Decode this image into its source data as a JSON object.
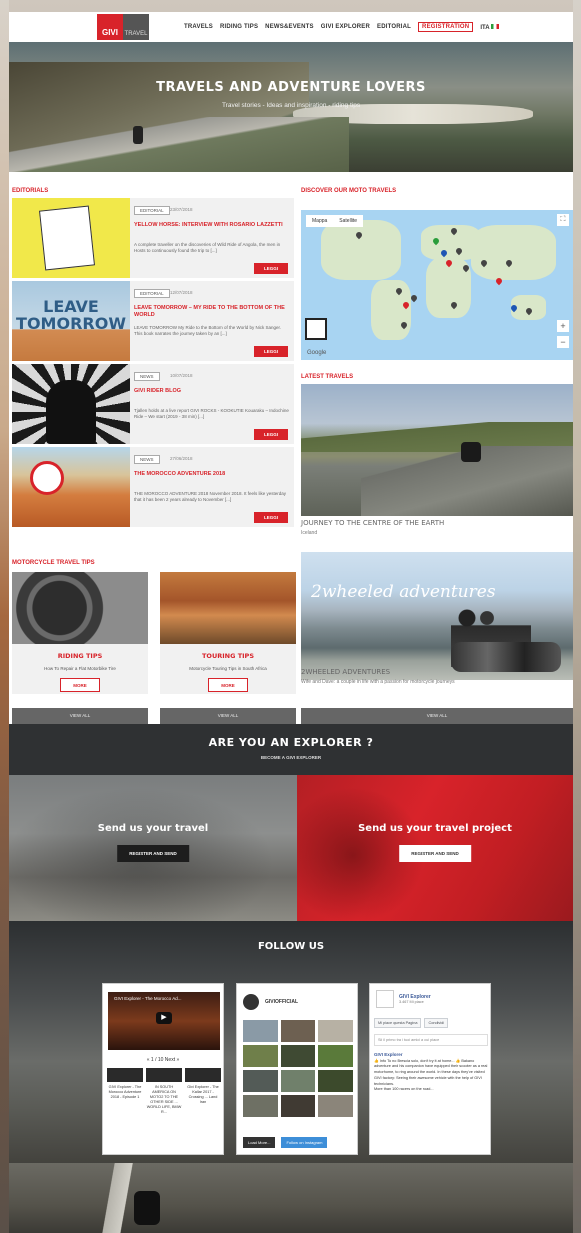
{
  "header": {
    "logo_main": "GIVI",
    "logo_sub": "TRAVEL",
    "nav": [
      "TRAVELS",
      "RIDING TIPS",
      "NEWS&EVENTS",
      "GIVI EXPLORER",
      "EDITORIAL"
    ],
    "register_label": "REGISTRATION",
    "lang": "ITA"
  },
  "hero": {
    "title": "TRAVELS AND ADVENTURE LOVERS",
    "subtitle": "Travel stories - Ideas and inspiration - riding tips"
  },
  "editorials": {
    "label": "EDITORIALS",
    "items": [
      {
        "tag": "EDITORIAL",
        "date": "23/07/2018",
        "title": "YELLOW HORSE: INTERVIEW WITH ROSARIO LAZZETTI",
        "text": "A complete traveller on the discoveries of Wild Ride of Angola, the men in Hosts to continuously found the trip to [...]",
        "btn": "LEGGI"
      },
      {
        "tag": "EDITORIAL",
        "date": "12/07/2018",
        "title": "LEAVE TOMORROW – MY RIDE TO THE BOTTOM OF THE WORLD",
        "text": "LEAVE TOMORROW My Ride to the Bottom of the World by Nick Sanger. This book narrates the journey taken by an [...]",
        "btn": "LEGGI"
      },
      {
        "tag": "NEWS",
        "date": "10/07/2018",
        "title": "GIVI RIDER BLOG",
        "text": "Tjallen holds at a live report GIVI ROCKS - KOOKUTIE Kouaraku – Indochine Ride – We start (2019 - 38 min) [...]",
        "btn": "LEGGI"
      },
      {
        "tag": "NEWS",
        "date": "27/06/2018",
        "title": "THE MOROCCO ADVENTURE 2018",
        "text": "THE MOROCCO ADVENTURE 2018 November 2018. It feels like yesterday that it has been 2 years already to November [...]",
        "btn": "LEGGI"
      }
    ],
    "thumb_text": "LEAVE TOMORROW"
  },
  "map": {
    "label": "DISCOVER OUR MOTO TRAVELS",
    "tab_map": "Mappa",
    "tab_sat": "Satellite",
    "google": "Google"
  },
  "latest": {
    "label": "LATEST TRAVELS",
    "items": [
      {
        "title": "JOURNEY TO THE CENTRE OF THE EARTH",
        "sub": "Iceland"
      },
      {
        "title": "2WHEELED ADVENTURES",
        "sub": "Wife and Dave: a couple in life with a passion for motorcycle journeys",
        "overlay": "2wheeled adventures"
      }
    ],
    "viewall": "VIEW ALL"
  },
  "tips": {
    "label": "MOTORCYCLE TRAVEL TIPS",
    "items": [
      {
        "title": "RIDING TIPS",
        "text": "How To Repair a Flat Motorbike Tire",
        "btn": "MORE",
        "viewall": "VIEW ALL"
      },
      {
        "title": "TOURING TIPS",
        "text": "Motorcycle Touring Tips in South Africa",
        "btn": "MORE",
        "viewall": "VIEW ALL"
      }
    ]
  },
  "explorer": {
    "title": "ARE YOU AN EXPLORER ?",
    "subtitle": "BECOME A GIVI EXPLORER"
  },
  "send": {
    "left_title": "Send us your travel",
    "left_btn": "REGISTER AND SEND",
    "right_title": "Send us your travel project",
    "right_btn": "REGISTER AND SEND"
  },
  "follow": {
    "title": "FOLLOW US",
    "youtube": {
      "caption": "GIVI Explorer - The Morocco Ad...",
      "pager": "« 1 / 10  Next »",
      "thumbs": [
        "GIVI Explorer - The Morocco Adventure 2018 - Episode 1",
        "IN SOUTH AMERICA ON MOTO2 TO THE OTHER SIDE ... WORLD LIFE, BMW R...",
        "Givi Explorer - The Kallar 2017 - Crossing ... Land Iran"
      ]
    },
    "instagram": {
      "username": "GIVIOFFICIAL",
      "btn_load": "Load More...",
      "btn_follow": "Follow on Instagram"
    },
    "facebook": {
      "name": "GIVI Explorer",
      "likes": "3.467 Mi piace",
      "btn_like": "Mi piace questa Pagina",
      "btn_share": "Condividi",
      "share_placeholder": "Sii il primo tra i tuoi amici a cui piace",
      "post_author": "GIVI Explorer",
      "post_text": "👍 Info To no Brescia solo, don't try it at home... 👍 Bakano adventure and his companion have equipped their scooter as a real motorhome, to ring around the world. In these days they've visited GIVI factory: Seeing their awesome vehicle with the help of GIVI technicians.",
      "post_meta": "More than 100 racers on the road..."
    }
  },
  "colors": {
    "accent": "#d8232a",
    "dark": "#2f3133",
    "facebook": "#3b5998"
  }
}
